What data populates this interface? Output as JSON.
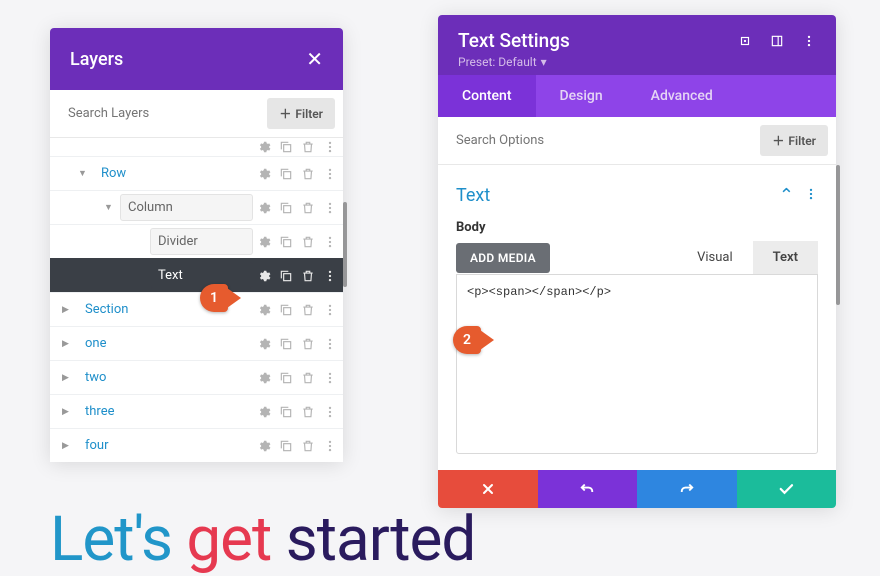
{
  "layers": {
    "title": "Layers",
    "search_placeholder": "Search Layers",
    "filter_label": "Filter",
    "items": [
      {
        "label": "Row",
        "type": "link",
        "indent": 1,
        "toggle": "down"
      },
      {
        "label": "Column",
        "type": "plain",
        "indent": 2,
        "toggle": "down"
      },
      {
        "label": "Divider",
        "type": "plain",
        "indent": 3,
        "toggle": ""
      },
      {
        "label": "Text",
        "type": "plain",
        "indent": 3,
        "toggle": "",
        "active": true
      },
      {
        "label": "Section",
        "type": "link",
        "indent": 0,
        "toggle": "right"
      },
      {
        "label": "one",
        "type": "link",
        "indent": 0,
        "toggle": "right"
      },
      {
        "label": "two",
        "type": "link",
        "indent": 0,
        "toggle": "right"
      },
      {
        "label": "three",
        "type": "link",
        "indent": 0,
        "toggle": "right"
      },
      {
        "label": "four",
        "type": "link",
        "indent": 0,
        "toggle": "right"
      }
    ]
  },
  "settings": {
    "title": "Text Settings",
    "preset": "Preset: Default",
    "tabs": [
      "Content",
      "Design",
      "Advanced"
    ],
    "active_tab": "Content",
    "search_placeholder": "Search Options",
    "filter_label": "Filter",
    "section_title": "Text",
    "body_label": "Body",
    "add_media": "ADD MEDIA",
    "editor_tabs": {
      "visual": "Visual",
      "text": "Text"
    },
    "editor_content": "<p><span></span></p>"
  },
  "hero": {
    "w1": "Let's ",
    "w2": "get ",
    "w3": "started"
  },
  "callouts": {
    "one": "1",
    "two": "2"
  }
}
